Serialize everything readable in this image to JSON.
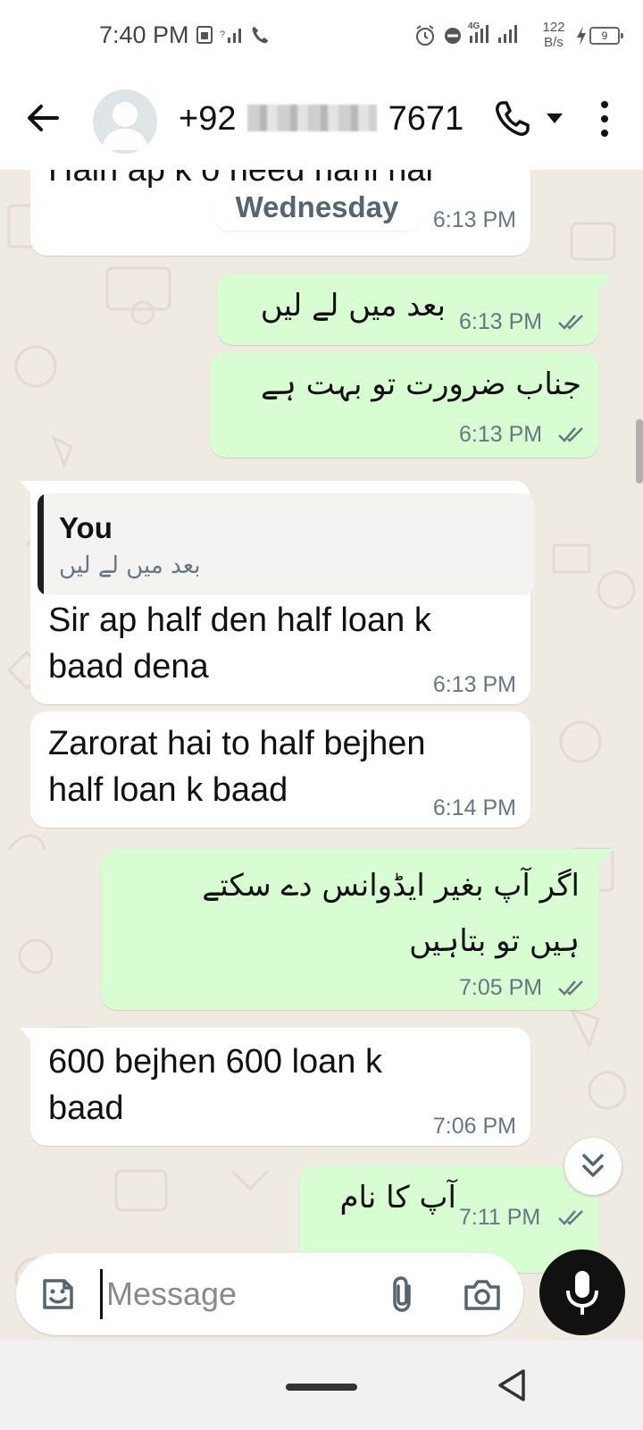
{
  "status_bar": {
    "time": "7:40 PM",
    "net_speed_value": "122",
    "net_speed_unit": "B/s",
    "network_label": "4G",
    "battery_level": "9"
  },
  "header": {
    "contact_prefix": "+92",
    "contact_suffix": "7671",
    "avatar_icon": "person-placeholder-icon"
  },
  "chat": {
    "date_chip": "Wednesday",
    "messages": [
      {
        "dir": "in",
        "text": "Hain ap k   o need nahi hai",
        "time": "6:13 PM"
      },
      {
        "dir": "out",
        "text": "بعد میں لے لیں",
        "time": "6:13 PM",
        "ticks": "read"
      },
      {
        "dir": "out",
        "text": "جناب ضرورت تو بہت ہے",
        "time": "6:13 PM",
        "ticks": "read"
      },
      {
        "dir": "in",
        "quote_author": "You",
        "quote_text": "بعد میں لے لیں",
        "text": "Sir ap half den half loan k\nbaad dena",
        "time": "6:13 PM"
      },
      {
        "dir": "in",
        "text": "Zarorat hai to half bejhen\nhalf loan k baad",
        "time": "6:14 PM"
      },
      {
        "dir": "out",
        "text": "اگر آپ بغیر ایڈوانس دے سکتے\nہیں تو بتاہیں",
        "time": "7:05 PM",
        "ticks": "read"
      },
      {
        "dir": "in",
        "text": "600 bejhen 600 loan k\nbaad",
        "time": "7:06 PM"
      },
      {
        "dir": "out",
        "text": "آپ کا نام",
        "time": "7:11 PM",
        "ticks": "read"
      }
    ]
  },
  "composer": {
    "placeholder": "Message"
  },
  "colors": {
    "chat_bg": "#efeae2",
    "incoming_bubble": "#ffffff",
    "outgoing_bubble": "#d9fdd3",
    "read_ticks": "#667781",
    "mic_button": "#111111"
  }
}
